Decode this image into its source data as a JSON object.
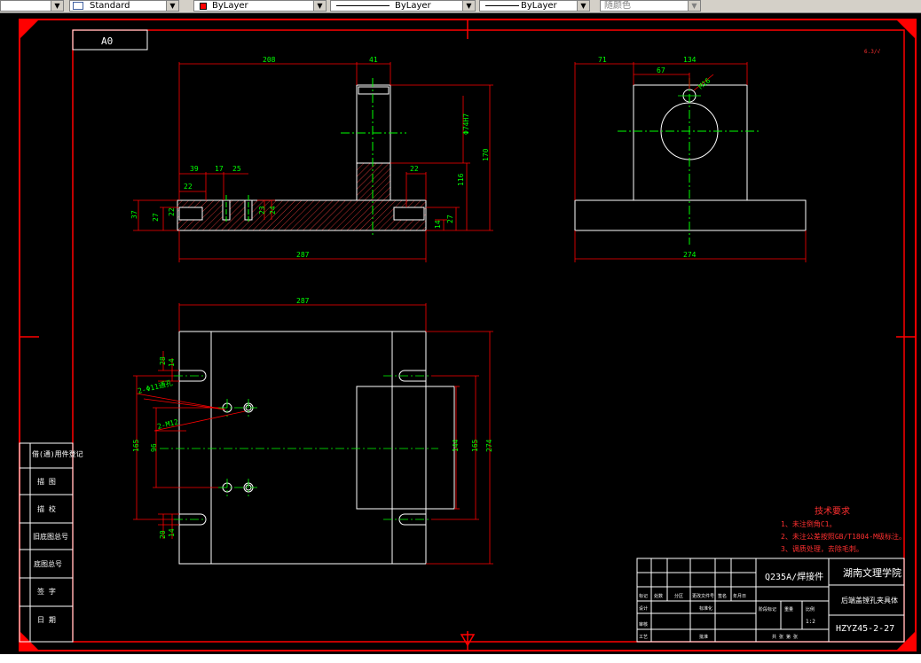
{
  "toolbar": {
    "text_style": "Standard",
    "layer_color": "ByLayer",
    "linetype": "ByLayer",
    "lineweight": "ByLayer",
    "plot_style": "随颜色"
  },
  "drawing": {
    "sheet_size": "A0",
    "top_view_dims": {
      "d208": "208",
      "d41": "41",
      "d39": "39",
      "d17": "17",
      "d25": "25",
      "d22a": "22",
      "d22b": "22",
      "d37": "37",
      "d27a": "27",
      "d27b": "27",
      "d22c": "22",
      "d23": "23",
      "d24": "24",
      "d14": "14",
      "d116": "116",
      "d170": "170",
      "dphi": "Φ74H7",
      "d287": "287"
    },
    "side_view_dims": {
      "d71": "71",
      "d134": "134",
      "d67": "67",
      "dm16": "M16",
      "d274": "274"
    },
    "plan_view_dims": {
      "d287": "287",
      "d28": "28",
      "d14a": "14",
      "d20": "20",
      "d14b": "14",
      "holes1": "2-Φ11通孔",
      "holes2": "2-M12",
      "d165a": "165",
      "d96": "96",
      "d144": "144",
      "d165b": "165",
      "d274": "274"
    },
    "tech_requirements": {
      "title": "技术要求",
      "items": [
        "1、未注倒角C1。",
        "2、未注公差按照GB/T1804-M级标注。",
        "3、调质处理，去除毛刺。"
      ]
    },
    "title_block": {
      "material": "Q235A/焊接件",
      "school": "湖南文理学院",
      "part_name": "后端盖镗孔夹具体",
      "drawing_no": "HZYZ45-2-27",
      "scale": "1:2",
      "labels_row1": [
        "标记",
        "处数",
        "分区",
        "更改文件号",
        "签名",
        "年月日"
      ],
      "label_design": "设计",
      "label_standard": "标准化",
      "label_review": "审核",
      "label_craft": "工艺",
      "label_approve": "批准",
      "label_stage": "阶段标记",
      "label_weight": "重量",
      "label_ratio": "比例",
      "label_sheets": "共 张 第 张"
    },
    "side_labels": [
      "借(通)用件登记",
      "描 图",
      "描 校",
      "旧底图总号",
      "底图总号",
      "签 字",
      "日 期"
    ]
  }
}
